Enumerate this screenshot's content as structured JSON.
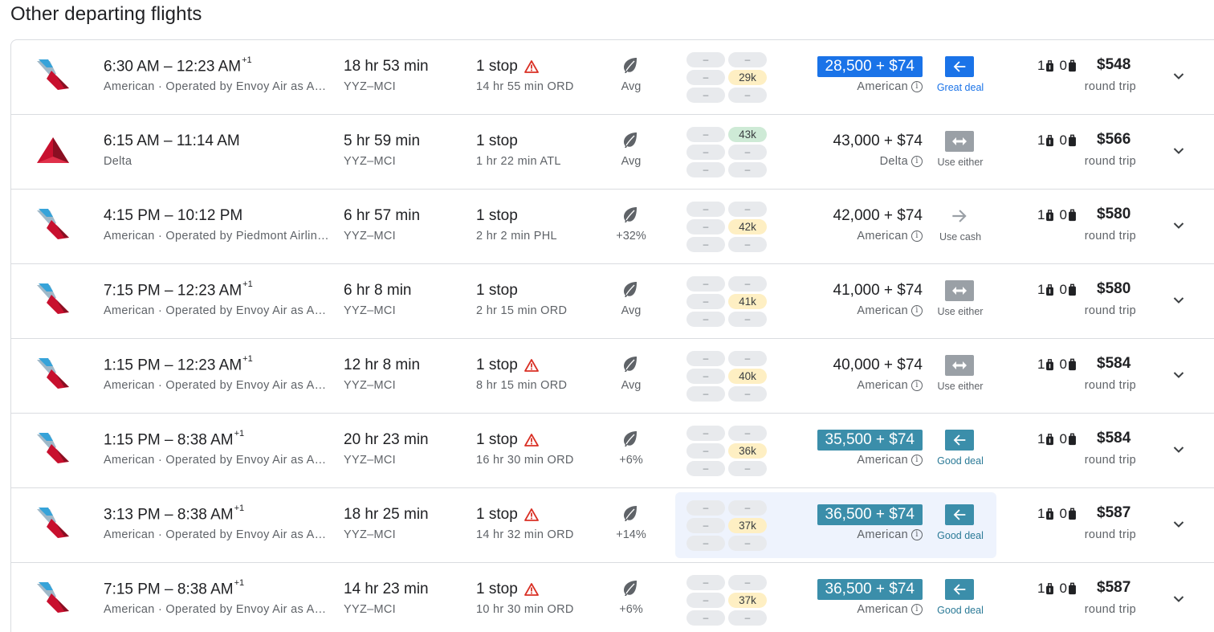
{
  "page_title": "Other departing flights",
  "colors": {
    "great_deal": "#1a73e8",
    "good_deal": "#3b8eaa",
    "use_either": "#9aa0a6",
    "warning": "#d93025",
    "american_logo_red": "#c8102e",
    "american_logo_blue": "#36a3d9",
    "delta_logo": "#c8102e"
  },
  "flights": [
    {
      "logo": "american-airlines-logo",
      "depart": "6:30 AM",
      "arrive": "12:23 AM",
      "day_offset": "+1",
      "airline": "American · Operated by Envoy Air as American Eagle",
      "duration": "18 hr 53 min",
      "route": "YYZ–MCI",
      "stops": "1 stop",
      "warning": true,
      "layover": "14 hr 55 min ORD",
      "emissions": "Avg",
      "award_grid": [
        "–",
        "–",
        "–",
        "29k",
        "–",
        "–"
      ],
      "award_highlight": "29k",
      "points": "28,500 + $74",
      "points_style": "great",
      "program": "American",
      "deal_icon": "left-arrow-icon",
      "deal_style": "blue",
      "deal_label": "Great deal",
      "carry_on": "1",
      "checked": "0",
      "price": "$548",
      "trip_type": "round trip",
      "highlighted": false
    },
    {
      "logo": "delta-logo",
      "depart": "6:15 AM",
      "arrive": "11:14 AM",
      "day_offset": "",
      "airline": "Delta",
      "duration": "5 hr 59 min",
      "route": "YYZ–MCI",
      "stops": "1 stop",
      "warning": false,
      "layover": "1 hr 22 min ATL",
      "emissions": "Avg",
      "award_grid": [
        "–",
        "43k",
        "–",
        "–",
        "–",
        "–"
      ],
      "award_highlight": "43k",
      "points": "43,000 + $74",
      "points_style": "plain",
      "program": "Delta",
      "deal_icon": "swap-arrows-icon",
      "deal_style": "grey",
      "deal_label": "Use either",
      "carry_on": "1",
      "checked": "0",
      "price": "$566",
      "trip_type": "round trip",
      "highlighted": false
    },
    {
      "logo": "american-airlines-logo",
      "depart": "4:15 PM",
      "arrive": "10:12 PM",
      "day_offset": "",
      "airline": "American · Operated by Piedmont Airlines as American Eagle",
      "duration": "6 hr 57 min",
      "route": "YYZ–MCI",
      "stops": "1 stop",
      "warning": false,
      "layover": "2 hr 2 min PHL",
      "emissions": "+32%",
      "award_grid": [
        "–",
        "–",
        "–",
        "42k",
        "–",
        "–"
      ],
      "award_highlight": "42k",
      "points": "42,000 + $74",
      "points_style": "plain",
      "program": "American",
      "deal_icon": "right-arrow-icon",
      "deal_style": "plain",
      "deal_label": "Use cash",
      "carry_on": "1",
      "checked": "0",
      "price": "$580",
      "trip_type": "round trip",
      "highlighted": false
    },
    {
      "logo": "american-airlines-logo",
      "depart": "7:15 PM",
      "arrive": "12:23 AM",
      "day_offset": "+1",
      "airline": "American · Operated by Envoy Air as American Eagle",
      "duration": "6 hr 8 min",
      "route": "YYZ–MCI",
      "stops": "1 stop",
      "warning": false,
      "layover": "2 hr 15 min ORD",
      "emissions": "Avg",
      "award_grid": [
        "–",
        "–",
        "–",
        "41k",
        "–",
        "–"
      ],
      "award_highlight": "41k",
      "points": "41,000 + $74",
      "points_style": "plain",
      "program": "American",
      "deal_icon": "swap-arrows-icon",
      "deal_style": "grey",
      "deal_label": "Use either",
      "carry_on": "1",
      "checked": "0",
      "price": "$580",
      "trip_type": "round trip",
      "highlighted": false
    },
    {
      "logo": "american-airlines-logo",
      "depart": "1:15 PM",
      "arrive": "12:23 AM",
      "day_offset": "+1",
      "airline": "American · Operated by Envoy Air as American Eagle",
      "duration": "12 hr 8 min",
      "route": "YYZ–MCI",
      "stops": "1 stop",
      "warning": true,
      "layover": "8 hr 15 min ORD",
      "emissions": "Avg",
      "award_grid": [
        "–",
        "–",
        "–",
        "40k",
        "–",
        "–"
      ],
      "award_highlight": "40k",
      "points": "40,000 + $74",
      "points_style": "plain",
      "program": "American",
      "deal_icon": "swap-arrows-icon",
      "deal_style": "grey",
      "deal_label": "Use either",
      "carry_on": "1",
      "checked": "0",
      "price": "$584",
      "trip_type": "round trip",
      "highlighted": false
    },
    {
      "logo": "american-airlines-logo",
      "depart": "1:15 PM",
      "arrive": "8:38 AM",
      "day_offset": "+1",
      "airline": "American · Operated by Envoy Air as American Eagle",
      "duration": "20 hr 23 min",
      "route": "YYZ–MCI",
      "stops": "1 stop",
      "warning": true,
      "layover": "16 hr 30 min ORD",
      "emissions": "+6%",
      "award_grid": [
        "–",
        "–",
        "–",
        "36k",
        "–",
        "–"
      ],
      "award_highlight": "36k",
      "points": "35,500 + $74",
      "points_style": "good",
      "program": "American",
      "deal_icon": "left-arrow-icon",
      "deal_style": "teal",
      "deal_label": "Good deal",
      "carry_on": "1",
      "checked": "0",
      "price": "$584",
      "trip_type": "round trip",
      "highlighted": false
    },
    {
      "logo": "american-airlines-logo",
      "depart": "3:13 PM",
      "arrive": "8:38 AM",
      "day_offset": "+1",
      "airline": "American · Operated by Envoy Air as American Eagle",
      "duration": "18 hr 25 min",
      "route": "YYZ–MCI",
      "stops": "1 stop",
      "warning": true,
      "layover": "14 hr 32 min ORD",
      "emissions": "+14%",
      "award_grid": [
        "–",
        "–",
        "–",
        "37k",
        "–",
        "–"
      ],
      "award_highlight": "37k",
      "points": "36,500 + $74",
      "points_style": "good",
      "program": "American",
      "deal_icon": "left-arrow-icon",
      "deal_style": "teal",
      "deal_label": "Good deal",
      "carry_on": "1",
      "checked": "0",
      "price": "$587",
      "trip_type": "round trip",
      "highlighted": true
    },
    {
      "logo": "american-airlines-logo",
      "depart": "7:15 PM",
      "arrive": "8:38 AM",
      "day_offset": "+1",
      "airline": "American · Operated by Envoy Air as American Eagle",
      "duration": "14 hr 23 min",
      "route": "YYZ–MCI",
      "stops": "1 stop",
      "warning": true,
      "layover": "10 hr 30 min ORD",
      "emissions": "+6%",
      "award_grid": [
        "–",
        "–",
        "–",
        "37k",
        "–",
        "–"
      ],
      "award_highlight": "37k",
      "points": "36,500 + $74",
      "points_style": "good",
      "program": "American",
      "deal_icon": "left-arrow-icon",
      "deal_style": "teal",
      "deal_label": "Good deal",
      "carry_on": "1",
      "checked": "0",
      "price": "$587",
      "trip_type": "round trip",
      "highlighted": false
    }
  ]
}
